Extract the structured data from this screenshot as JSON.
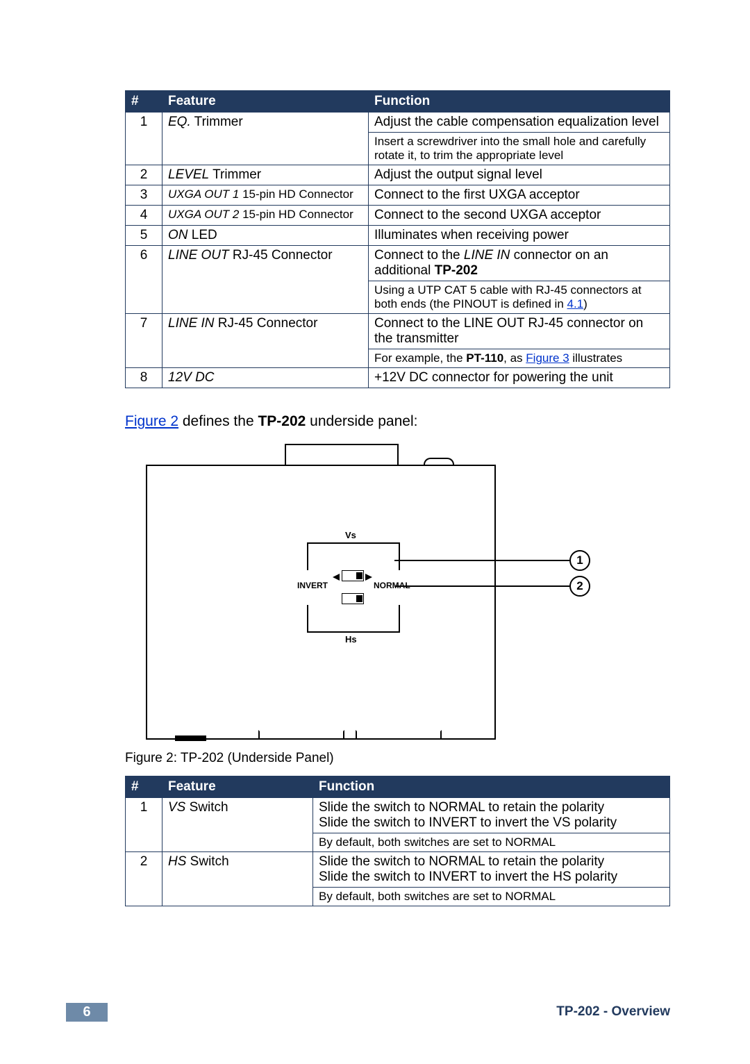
{
  "table1": {
    "headers": {
      "num": "#",
      "feature": "Feature",
      "function": "Function"
    },
    "rows": [
      {
        "num": "1",
        "feat_i": "EQ.",
        "feat_r": " Trimmer",
        "func": "Adjust the cable compensation equalization level",
        "note": "Insert a screwdriver into the small hole and carefully rotate it, to trim the appropriate level"
      },
      {
        "num": "2",
        "feat_i": "LEVEL",
        "feat_r": " Trimmer",
        "func": "Adjust the output signal level"
      },
      {
        "num": "3",
        "feat_i": "UXGA OUT 1",
        "feat_r": " 15-pin HD Connector",
        "func": "Connect to the first UXGA acceptor"
      },
      {
        "num": "4",
        "feat_i": "UXGA OUT 2",
        "feat_r": " 15-pin HD Connector",
        "func": "Connect to the second UXGA acceptor"
      },
      {
        "num": "5",
        "feat_i": "ON",
        "feat_r": " LED",
        "func": "Illuminates when receiving power"
      },
      {
        "num": "6",
        "feat_i": "LINE OUT",
        "feat_r": " RJ-45 Connector",
        "func_pre": "Connect to the ",
        "func_i": "LINE IN",
        "func_post": " connector on an additional ",
        "func_bold": "TP-202",
        "note_pre": "Using a UTP CAT 5 cable with RJ-45 connectors at both ends (the PINOUT is defined in ",
        "note_link": "4.1",
        "note_post": ")"
      },
      {
        "num": "7",
        "feat_i": "LINE IN",
        "feat_r": " RJ-45 Connector",
        "func": "Connect to the LINE OUT RJ-45 connector on the transmitter",
        "note_pre": "For example, the ",
        "note_bold": "PT-110",
        "note_mid": ", as ",
        "note_link": "Figure 3",
        "note_post": " illustrates"
      },
      {
        "num": "8",
        "feat_i": "12V DC",
        "feat_r": "",
        "func": "+12V DC connector for powering the unit"
      }
    ]
  },
  "para": {
    "link": "Figure 2",
    "mid": " defines the ",
    "bold": "TP-202",
    "end": " underside panel:"
  },
  "figure": {
    "vs": "Vs",
    "hs": "Hs",
    "invert": "INVERT",
    "normal": "NORMAL",
    "callout1": "1",
    "callout2": "2"
  },
  "caption": "Figure 2: TP-202 (Underside Panel)",
  "table2": {
    "headers": {
      "num": "#",
      "feature": "Feature",
      "function": "Function"
    },
    "rows": [
      {
        "num": "1",
        "feat_i": "VS",
        "feat_r": " Switch",
        "func1": "Slide the switch to NORMAL to retain the polarity",
        "func2": "Slide the switch to INVERT to invert the VS polarity",
        "note": "By default, both switches are set to NORMAL"
      },
      {
        "num": "2",
        "feat_i": "HS",
        "feat_r": " Switch",
        "func1": "Slide the switch to NORMAL to retain the polarity",
        "func2": "Slide the switch to INVERT to invert the HS polarity",
        "note": "By default, both switches are set to NORMAL"
      }
    ]
  },
  "footer": {
    "page": "6",
    "title": "TP-202 - Overview"
  }
}
